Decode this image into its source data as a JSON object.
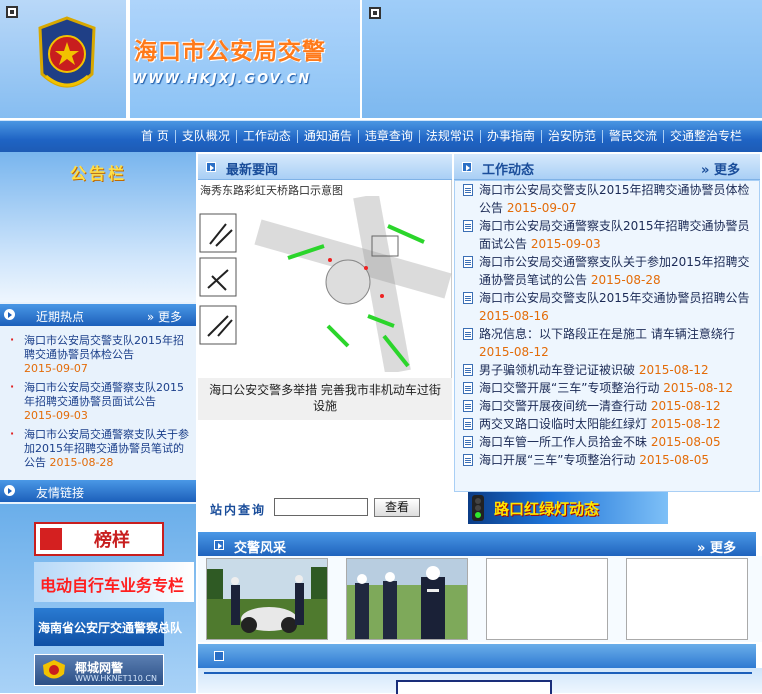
{
  "header": {
    "site_title": "海口市公安局交警",
    "site_url": "WWW.HKJXJ.GOV.CN"
  },
  "nav": {
    "items": [
      "首 页",
      "支队概况",
      "工作动态",
      "通知通告",
      "违章查询",
      "法规常识",
      "办事指南",
      "治安防范",
      "警民交流",
      "交通整治专栏"
    ]
  },
  "sidebar": {
    "notice_title": "公告栏",
    "hot_title": "近期热点",
    "hot_more": "更多",
    "hot_items": [
      {
        "text": "海口市公安局交警支队2015年招聘交通协警员体检公告",
        "date": "2015-09-07"
      },
      {
        "text": "海口市公安局交通警察支队2015年招聘交通协警员面试公告",
        "date": "2015-09-03"
      },
      {
        "text": "海口市公安局交通警察支队关于参加2015年招聘交通协警员笔试的公告",
        "date": "2015-08-28"
      }
    ],
    "links_title": "友情链接",
    "links": [
      "榜样",
      "电动自行车业务专栏",
      "海南省公安厅交通警察总队",
      "椰城网警"
    ],
    "link4_sub": "WWW.HKNET110.CN"
  },
  "main": {
    "latest_title": "最新要闻",
    "work_title": "工作动态",
    "work_more": "更多",
    "photo_heading": "海秀东路彩虹天桥路口示意图",
    "photo_caption": "海口公安交警多举措 完善我市非机动车过街设施",
    "news": [
      {
        "text": "海口市公安局交警支队2015年招聘交通协警员体检公告",
        "date": "2015-09-07"
      },
      {
        "text": "海口市公安局交通警察支队2015年招聘交通协警员面试公告",
        "date": "2015-09-03"
      },
      {
        "text": "海口市公安局交通警察支队关于参加2015年招聘交通协警员笔试的公告",
        "date": "2015-08-28"
      },
      {
        "text": "海口市公安局交警支队2015年交通协警员招聘公告",
        "date": "2015-08-16"
      },
      {
        "text": "路况信息：以下路段正在是施工 请车辆注意绕行",
        "date": "2015-08-12"
      },
      {
        "text": "男子骗领机动车登记证被识破",
        "date": "2015-08-12"
      },
      {
        "text": "海口交警开展“三车”专项整治行动",
        "date": "2015-08-12"
      },
      {
        "text": "海口交警开展夜间统一清查行动",
        "date": "2015-08-12"
      },
      {
        "text": "两交叉路口设临时太阳能红绿灯",
        "date": "2015-08-12"
      },
      {
        "text": "海口车管一所工作人员拾金不昧",
        "date": "2015-08-05"
      },
      {
        "text": "海口开展“三车”专项整治行动",
        "date": "2015-08-05"
      }
    ],
    "search_label": "站内查询",
    "search_value": "",
    "search_button": "查看",
    "signal_banner": "路口红绿灯动态",
    "gallery_title": "交警风采",
    "gallery_more": "更多"
  }
}
